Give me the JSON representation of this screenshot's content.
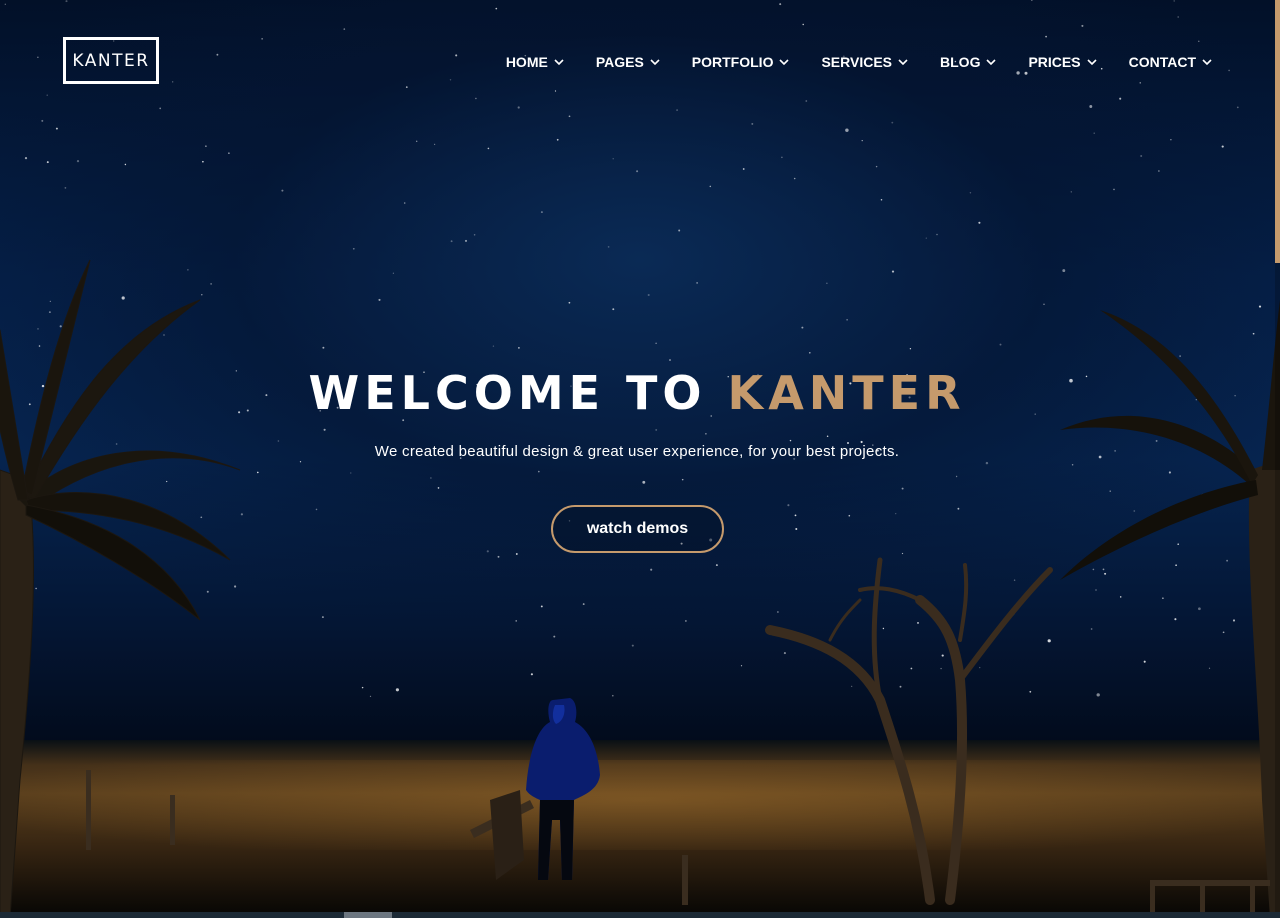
{
  "brand": {
    "logo_text": "KANTER"
  },
  "nav": {
    "items": [
      {
        "label": "HOME"
      },
      {
        "label": "PAGES"
      },
      {
        "label": "PORTFOLIO"
      },
      {
        "label": "SERVICES"
      },
      {
        "label": "BLOG"
      },
      {
        "label": "PRICES"
      },
      {
        "label": "CONTACT"
      }
    ]
  },
  "hero": {
    "headline_prefix": "WELCOME TO",
    "headline_accent": "KANTER",
    "subtitle": "We created beautiful design & great user experience, for your best projects.",
    "cta_label": "watch demos"
  },
  "colors": {
    "accent": "#c59a6c",
    "text": "#ffffff",
    "sky": "#052049"
  },
  "icons": {
    "nav_dropdown": "chevron-down-icon"
  }
}
